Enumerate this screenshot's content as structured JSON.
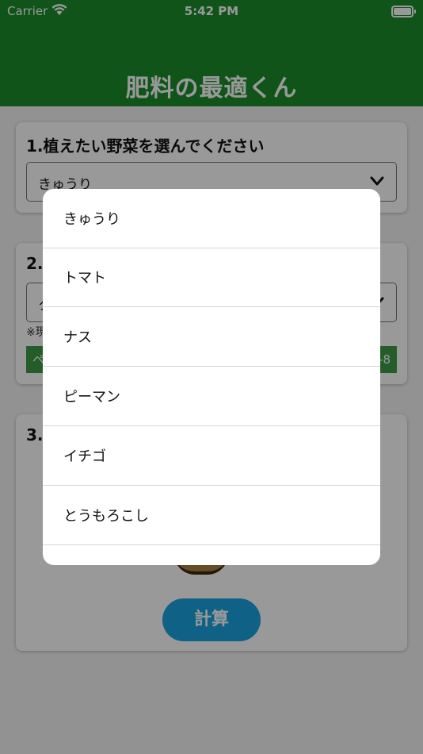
{
  "status_bar": {
    "carrier": "Carrier",
    "time": "5:42 PM"
  },
  "header": {
    "title": "肥料の最適くん"
  },
  "section1": {
    "title": "1.植えたい野菜を選んでください",
    "selected_value": "きゅうり"
  },
  "section2": {
    "title_visible": "2.",
    "selected_value_visible": "ク",
    "note_visible": "※現",
    "tag_left_visible": "ペ",
    "tag_right_visible": "-8"
  },
  "section3": {
    "title_visible": "3.",
    "calc_button": "計算"
  },
  "picker": {
    "options": [
      "きゅうり",
      "トマト",
      "ナス",
      "ピーマン",
      "イチゴ",
      "とうもろこし"
    ]
  },
  "colors": {
    "header": "#1c8c2c",
    "button": "#1aa3e0",
    "tag": "#3d9b47"
  }
}
